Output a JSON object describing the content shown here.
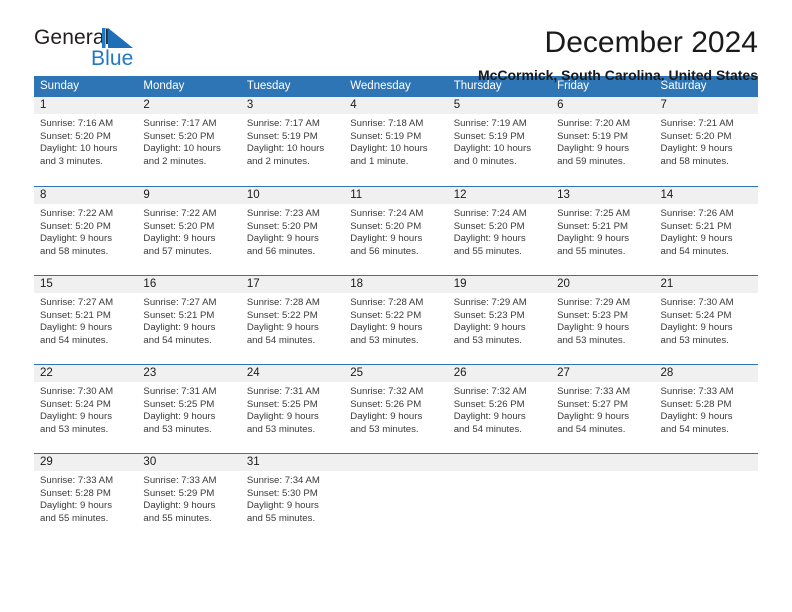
{
  "brand": {
    "name_part1": "General",
    "name_part2": "Blue",
    "logo_icon": "triangle-icon"
  },
  "header": {
    "title": "December 2024",
    "subtitle": "McCormick, South Carolina, United States"
  },
  "colors": {
    "header_blue": "#2E75B6",
    "brand_blue": "#2079C7",
    "daynum_band": "#F0F0F0",
    "text": "#1A1A1A"
  },
  "weekday_headers": [
    "Sunday",
    "Monday",
    "Tuesday",
    "Wednesday",
    "Thursday",
    "Friday",
    "Saturday"
  ],
  "weeks": [
    [
      {
        "day": "1",
        "sunrise": "Sunrise: 7:16 AM",
        "sunset": "Sunset: 5:20 PM",
        "daylight1": "Daylight: 10 hours",
        "daylight2": "and 3 minutes."
      },
      {
        "day": "2",
        "sunrise": "Sunrise: 7:17 AM",
        "sunset": "Sunset: 5:20 PM",
        "daylight1": "Daylight: 10 hours",
        "daylight2": "and 2 minutes."
      },
      {
        "day": "3",
        "sunrise": "Sunrise: 7:17 AM",
        "sunset": "Sunset: 5:19 PM",
        "daylight1": "Daylight: 10 hours",
        "daylight2": "and 2 minutes."
      },
      {
        "day": "4",
        "sunrise": "Sunrise: 7:18 AM",
        "sunset": "Sunset: 5:19 PM",
        "daylight1": "Daylight: 10 hours",
        "daylight2": "and 1 minute."
      },
      {
        "day": "5",
        "sunrise": "Sunrise: 7:19 AM",
        "sunset": "Sunset: 5:19 PM",
        "daylight1": "Daylight: 10 hours",
        "daylight2": "and 0 minutes."
      },
      {
        "day": "6",
        "sunrise": "Sunrise: 7:20 AM",
        "sunset": "Sunset: 5:19 PM",
        "daylight1": "Daylight: 9 hours",
        "daylight2": "and 59 minutes."
      },
      {
        "day": "7",
        "sunrise": "Sunrise: 7:21 AM",
        "sunset": "Sunset: 5:20 PM",
        "daylight1": "Daylight: 9 hours",
        "daylight2": "and 58 minutes."
      }
    ],
    [
      {
        "day": "8",
        "sunrise": "Sunrise: 7:22 AM",
        "sunset": "Sunset: 5:20 PM",
        "daylight1": "Daylight: 9 hours",
        "daylight2": "and 58 minutes."
      },
      {
        "day": "9",
        "sunrise": "Sunrise: 7:22 AM",
        "sunset": "Sunset: 5:20 PM",
        "daylight1": "Daylight: 9 hours",
        "daylight2": "and 57 minutes."
      },
      {
        "day": "10",
        "sunrise": "Sunrise: 7:23 AM",
        "sunset": "Sunset: 5:20 PM",
        "daylight1": "Daylight: 9 hours",
        "daylight2": "and 56 minutes."
      },
      {
        "day": "11",
        "sunrise": "Sunrise: 7:24 AM",
        "sunset": "Sunset: 5:20 PM",
        "daylight1": "Daylight: 9 hours",
        "daylight2": "and 56 minutes."
      },
      {
        "day": "12",
        "sunrise": "Sunrise: 7:24 AM",
        "sunset": "Sunset: 5:20 PM",
        "daylight1": "Daylight: 9 hours",
        "daylight2": "and 55 minutes."
      },
      {
        "day": "13",
        "sunrise": "Sunrise: 7:25 AM",
        "sunset": "Sunset: 5:21 PM",
        "daylight1": "Daylight: 9 hours",
        "daylight2": "and 55 minutes."
      },
      {
        "day": "14",
        "sunrise": "Sunrise: 7:26 AM",
        "sunset": "Sunset: 5:21 PM",
        "daylight1": "Daylight: 9 hours",
        "daylight2": "and 54 minutes."
      }
    ],
    [
      {
        "day": "15",
        "sunrise": "Sunrise: 7:27 AM",
        "sunset": "Sunset: 5:21 PM",
        "daylight1": "Daylight: 9 hours",
        "daylight2": "and 54 minutes."
      },
      {
        "day": "16",
        "sunrise": "Sunrise: 7:27 AM",
        "sunset": "Sunset: 5:21 PM",
        "daylight1": "Daylight: 9 hours",
        "daylight2": "and 54 minutes."
      },
      {
        "day": "17",
        "sunrise": "Sunrise: 7:28 AM",
        "sunset": "Sunset: 5:22 PM",
        "daylight1": "Daylight: 9 hours",
        "daylight2": "and 54 minutes."
      },
      {
        "day": "18",
        "sunrise": "Sunrise: 7:28 AM",
        "sunset": "Sunset: 5:22 PM",
        "daylight1": "Daylight: 9 hours",
        "daylight2": "and 53 minutes."
      },
      {
        "day": "19",
        "sunrise": "Sunrise: 7:29 AM",
        "sunset": "Sunset: 5:23 PM",
        "daylight1": "Daylight: 9 hours",
        "daylight2": "and 53 minutes."
      },
      {
        "day": "20",
        "sunrise": "Sunrise: 7:29 AM",
        "sunset": "Sunset: 5:23 PM",
        "daylight1": "Daylight: 9 hours",
        "daylight2": "and 53 minutes."
      },
      {
        "day": "21",
        "sunrise": "Sunrise: 7:30 AM",
        "sunset": "Sunset: 5:24 PM",
        "daylight1": "Daylight: 9 hours",
        "daylight2": "and 53 minutes."
      }
    ],
    [
      {
        "day": "22",
        "sunrise": "Sunrise: 7:30 AM",
        "sunset": "Sunset: 5:24 PM",
        "daylight1": "Daylight: 9 hours",
        "daylight2": "and 53 minutes."
      },
      {
        "day": "23",
        "sunrise": "Sunrise: 7:31 AM",
        "sunset": "Sunset: 5:25 PM",
        "daylight1": "Daylight: 9 hours",
        "daylight2": "and 53 minutes."
      },
      {
        "day": "24",
        "sunrise": "Sunrise: 7:31 AM",
        "sunset": "Sunset: 5:25 PM",
        "daylight1": "Daylight: 9 hours",
        "daylight2": "and 53 minutes."
      },
      {
        "day": "25",
        "sunrise": "Sunrise: 7:32 AM",
        "sunset": "Sunset: 5:26 PM",
        "daylight1": "Daylight: 9 hours",
        "daylight2": "and 53 minutes."
      },
      {
        "day": "26",
        "sunrise": "Sunrise: 7:32 AM",
        "sunset": "Sunset: 5:26 PM",
        "daylight1": "Daylight: 9 hours",
        "daylight2": "and 54 minutes."
      },
      {
        "day": "27",
        "sunrise": "Sunrise: 7:33 AM",
        "sunset": "Sunset: 5:27 PM",
        "daylight1": "Daylight: 9 hours",
        "daylight2": "and 54 minutes."
      },
      {
        "day": "28",
        "sunrise": "Sunrise: 7:33 AM",
        "sunset": "Sunset: 5:28 PM",
        "daylight1": "Daylight: 9 hours",
        "daylight2": "and 54 minutes."
      }
    ],
    [
      {
        "day": "29",
        "sunrise": "Sunrise: 7:33 AM",
        "sunset": "Sunset: 5:28 PM",
        "daylight1": "Daylight: 9 hours",
        "daylight2": "and 55 minutes."
      },
      {
        "day": "30",
        "sunrise": "Sunrise: 7:33 AM",
        "sunset": "Sunset: 5:29 PM",
        "daylight1": "Daylight: 9 hours",
        "daylight2": "and 55 minutes."
      },
      {
        "day": "31",
        "sunrise": "Sunrise: 7:34 AM",
        "sunset": "Sunset: 5:30 PM",
        "daylight1": "Daylight: 9 hours",
        "daylight2": "and 55 minutes."
      },
      {
        "day": "",
        "sunrise": "",
        "sunset": "",
        "daylight1": "",
        "daylight2": ""
      },
      {
        "day": "",
        "sunrise": "",
        "sunset": "",
        "daylight1": "",
        "daylight2": ""
      },
      {
        "day": "",
        "sunrise": "",
        "sunset": "",
        "daylight1": "",
        "daylight2": ""
      },
      {
        "day": "",
        "sunrise": "",
        "sunset": "",
        "daylight1": "",
        "daylight2": ""
      }
    ]
  ]
}
